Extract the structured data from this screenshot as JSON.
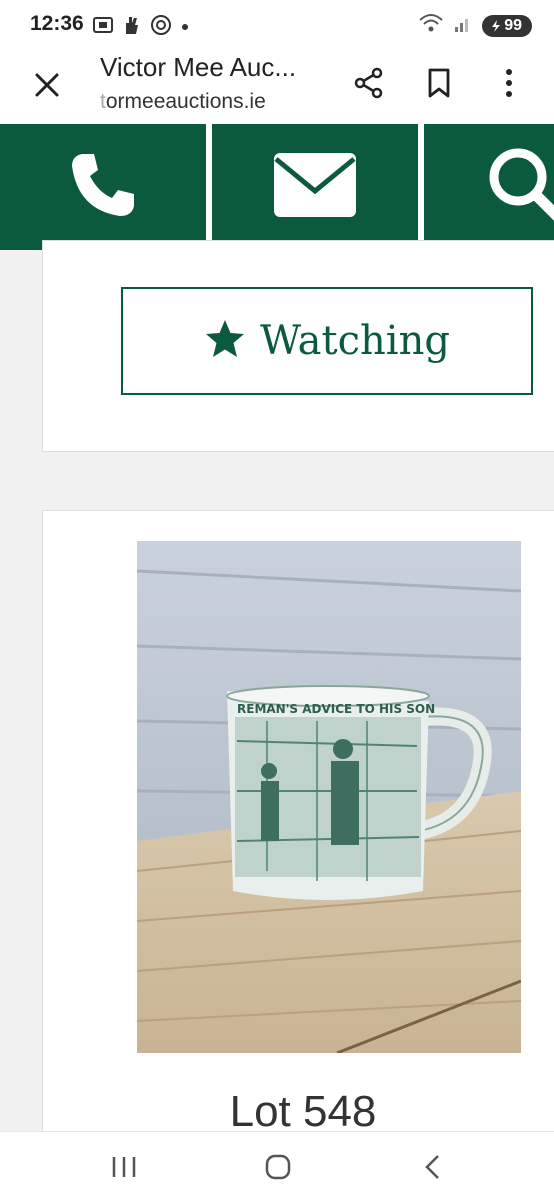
{
  "status_bar": {
    "time": "12:36",
    "battery_level": "99",
    "left_icons": [
      "screenshot-icon",
      "hand-icon",
      "at-icon",
      "dot-icon"
    ],
    "right_icons": [
      "wifi-icon",
      "signal-icon",
      "battery-icon"
    ]
  },
  "tab_header": {
    "title": "Victor Mee Auc...",
    "url_faded_prefix": "t",
    "url_rest": "ormeeauctions.ie",
    "icons": [
      "close-icon",
      "share-icon",
      "bookmark-icon",
      "more-vert-icon"
    ]
  },
  "action_bar": {
    "color": "#0c5a3d",
    "items": [
      "phone-icon",
      "email-icon",
      "search-icon"
    ]
  },
  "watch_card": {
    "button_label": "Watching",
    "icon": "star-icon"
  },
  "lot_card": {
    "mug_text": "REMAN'S ADVICE TO HIS SON",
    "lot_label": "Lot 548"
  },
  "nav_bar": {
    "items": [
      "recent-apps-icon",
      "home-icon",
      "back-icon"
    ]
  }
}
